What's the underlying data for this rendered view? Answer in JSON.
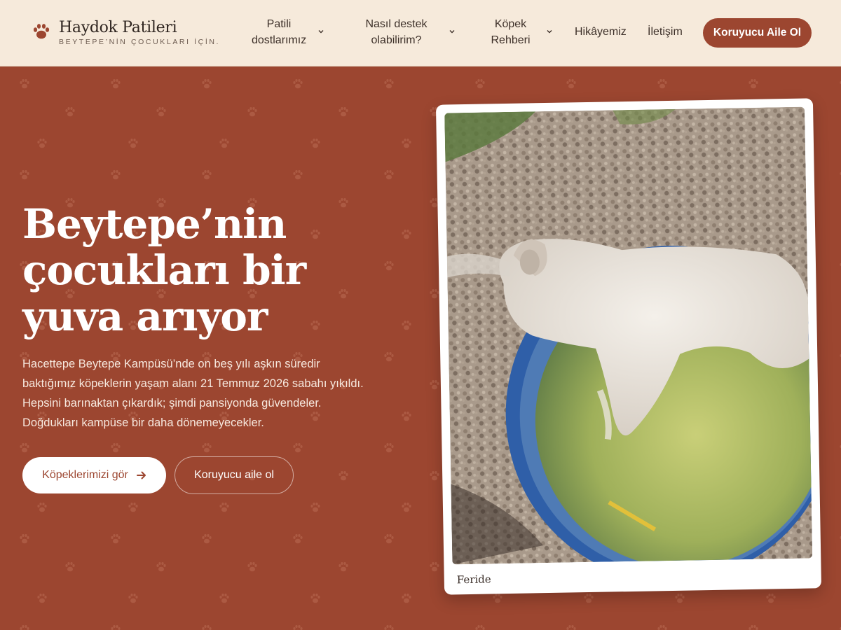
{
  "header": {
    "logo_name": "Haydok Patileri",
    "logo_tagline": "BEYTEPE’NİN ÇOCUKLARI İÇİN.",
    "nav": [
      {
        "label_line1": "Patili",
        "label_line2": "dostlarımız",
        "has_dropdown": true
      },
      {
        "label_line1": "Nasıl destek",
        "label_line2": "olabilirim?",
        "has_dropdown": true
      },
      {
        "label_line1": "Köpek",
        "label_line2": "Rehberi",
        "has_dropdown": true
      },
      {
        "label": "Hikâyemiz",
        "has_dropdown": false
      },
      {
        "label": "İletişim",
        "has_dropdown": false
      }
    ],
    "cta_label": "Koruyucu Aile Ol"
  },
  "hero": {
    "title_line1": "Beytepe’nin",
    "title_line2": "çocukları bir",
    "title_line3": "yuva arıyor",
    "text_line1": "Hacettepe Beytepe Kampüsü’nde on beş yılı aşkın süredir",
    "text_line2": "baktığımız köpeklerin yaşam alanı 21 Temmuz 2026 sabahı yıkıldı.",
    "text_line3": "Hepsini barınaktan çıkardık; şimdi pansiyonda güvendeler.",
    "text_line4": "Doğdukları kampüse bir daha dönemeyecekler.",
    "primary_button": "Köpeklerimizi gör",
    "primary_button_icon": "arrow-right-icon",
    "secondary_button": "Koruyucu aile ol",
    "photo_caption": "Feride"
  },
  "colors": {
    "brand": "#9c4630",
    "header_bg": "#f6eadb",
    "text_dark": "#3d3029",
    "white": "#ffffff"
  }
}
